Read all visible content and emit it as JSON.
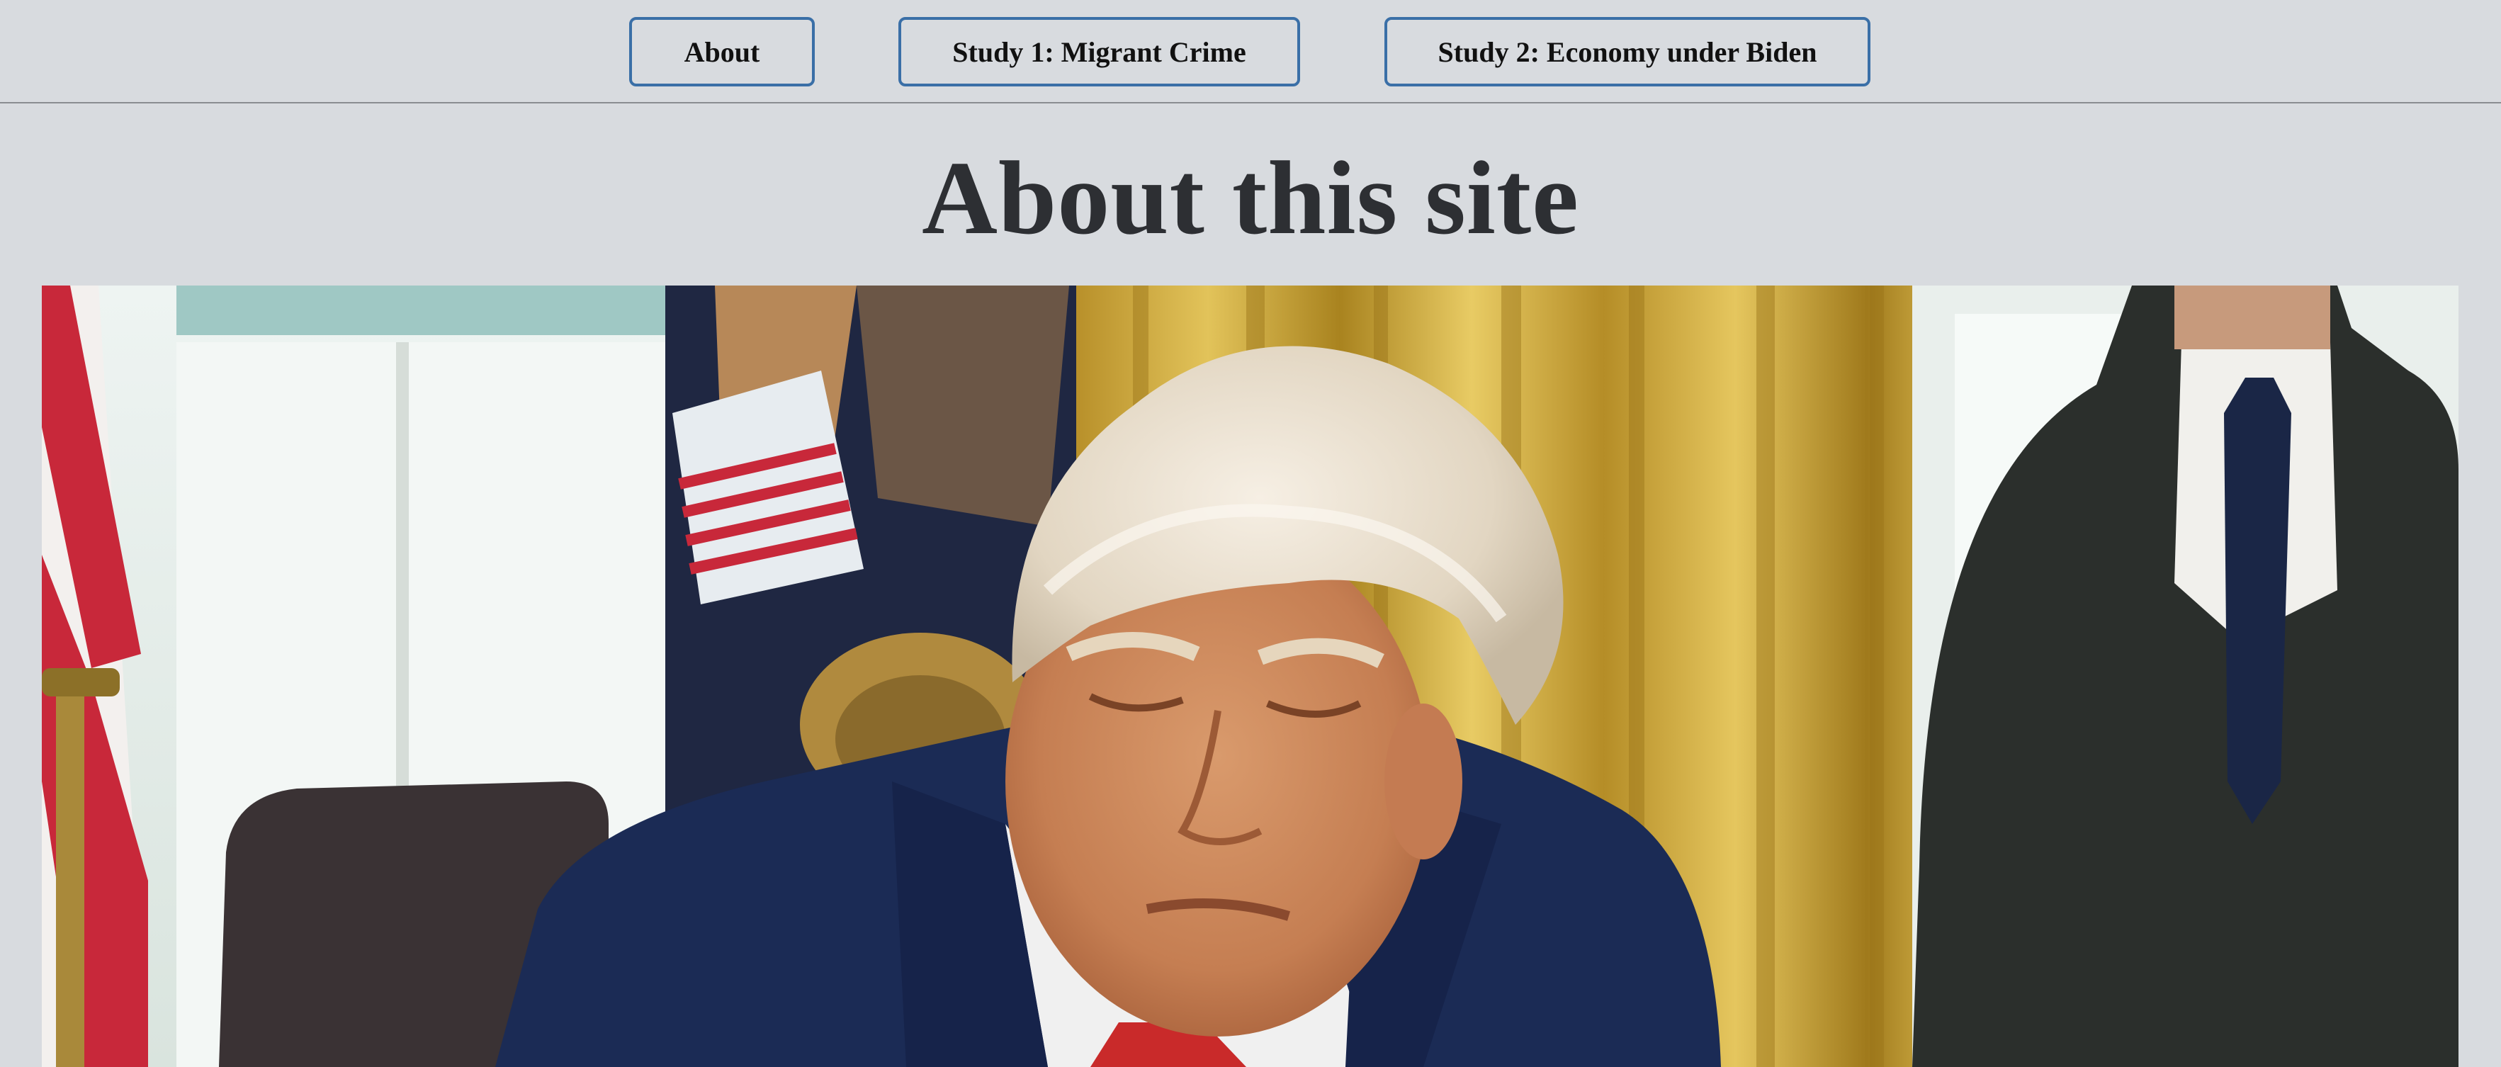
{
  "nav": {
    "about_label": "About",
    "study1_label": "Study 1: Migrant Crime",
    "study2_label": "Study 2: Economy under Biden"
  },
  "page": {
    "title": "About this site"
  },
  "colors": {
    "background": "#d8dbdf",
    "button_border": "#3a6fa7",
    "title": "#2d2f33"
  }
}
